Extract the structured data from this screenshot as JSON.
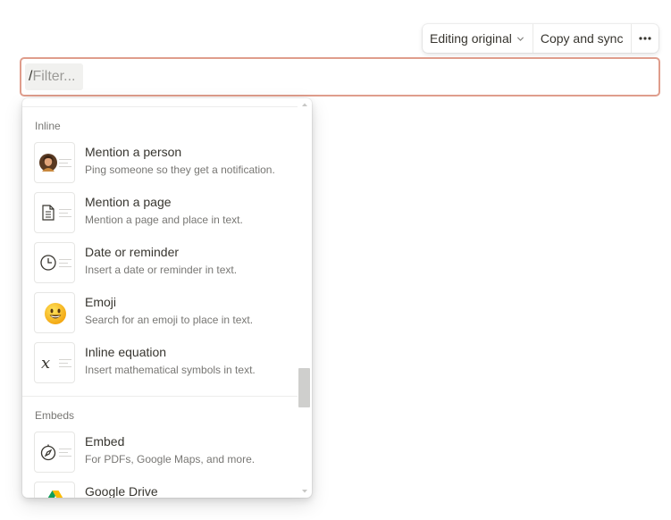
{
  "toolbar": {
    "editing_label": "Editing original",
    "copy_sync_label": "Copy and sync",
    "more_icon": "more-horizontal-icon"
  },
  "filter": {
    "prefix": "/",
    "placeholder": "Filter..."
  },
  "menu": {
    "sections": [
      {
        "label": "Inline",
        "items": [
          {
            "title": "Mention a person",
            "desc": "Ping someone so they get a notification.",
            "icon": "person-avatar-icon"
          },
          {
            "title": "Mention a page",
            "desc": "Mention a page and place in text.",
            "icon": "page-icon"
          },
          {
            "title": "Date or reminder",
            "desc": "Insert a date or reminder in text.",
            "icon": "clock-icon"
          },
          {
            "title": "Emoji",
            "desc": "Search for an emoji to place in text.",
            "icon": "smiley-emoji-icon"
          },
          {
            "title": "Inline equation",
            "desc": "Insert mathematical symbols in text.",
            "icon": "equation-x-icon"
          }
        ]
      },
      {
        "label": "Embeds",
        "items": [
          {
            "title": "Embed",
            "desc": "For PDFs, Google Maps, and more.",
            "icon": "compass-icon"
          },
          {
            "title": "Google Drive",
            "desc": "",
            "icon": "google-drive-icon"
          }
        ]
      }
    ]
  },
  "colors": {
    "focus_border": "#df9d8c",
    "text": "#37352f",
    "muted": "#787774"
  }
}
